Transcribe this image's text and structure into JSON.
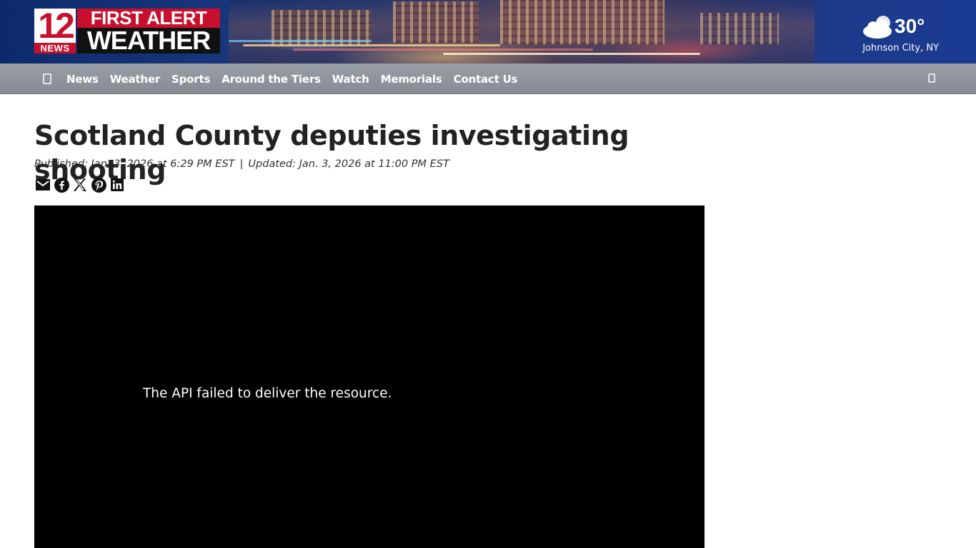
{
  "header": {
    "logo": {
      "number": "12",
      "news": "NEWS",
      "first_alert": "FIRST ALERT",
      "weather": "WEATHER"
    },
    "weather": {
      "temperature": "30°",
      "location": "Johnson City, NY",
      "icon": "partly-cloudy-icon"
    }
  },
  "nav": {
    "home_icon": "home-icon",
    "items": [
      "News",
      "Weather",
      "Sports",
      "Around the Tiers",
      "Watch",
      "Memorials",
      "Contact Us"
    ],
    "search_icon": "search-icon"
  },
  "article": {
    "title": "Scotland County deputies investigating shooting",
    "published": "Published: Jan. 3, 2026 at 6:29 PM EST",
    "separator": "|",
    "updated": "Updated: Jan. 3, 2026 at 11:00 PM EST",
    "share_icons": [
      "email-icon",
      "facebook-icon",
      "x-icon",
      "pinterest-icon",
      "linkedin-icon"
    ]
  },
  "video": {
    "error_message": "The API failed to deliver the resource."
  },
  "colors": {
    "brand_red": "#c8102e",
    "nav_gray": "#8f939b",
    "header_blue": "#17357a",
    "title_text": "#222222"
  }
}
